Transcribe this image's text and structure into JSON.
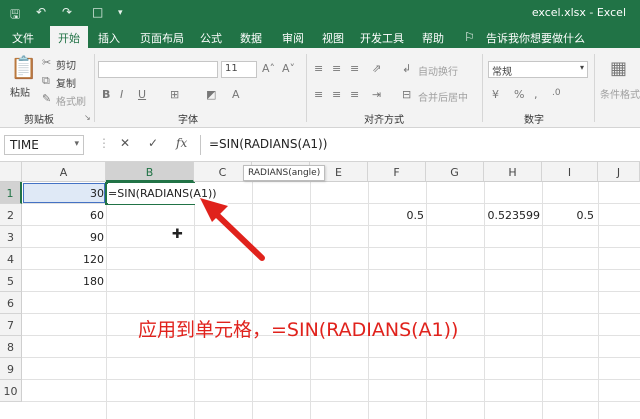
{
  "app": {
    "title": "excel.xlsx - Excel"
  },
  "tabs": [
    {
      "label": "文件"
    },
    {
      "label": "开始"
    },
    {
      "label": "插入"
    },
    {
      "label": "页面布局"
    },
    {
      "label": "公式"
    },
    {
      "label": "数据"
    },
    {
      "label": "审阅"
    },
    {
      "label": "视图"
    },
    {
      "label": "开发工具"
    },
    {
      "label": "帮助"
    }
  ],
  "tell_me": "告诉我你想要做什么",
  "ribbon": {
    "clipboard": {
      "paste": "粘贴",
      "cut": "剪切",
      "copy": "复制",
      "format_painter": "格式刷",
      "group": "剪贴板"
    },
    "font": {
      "size": "11",
      "group": "字体"
    },
    "alignment": {
      "wrap": "自动换行",
      "merge": "合并后居中",
      "group": "对齐方式"
    },
    "number": {
      "format": "常规",
      "group": "数字"
    },
    "styles": {
      "conditional": "条件格式"
    }
  },
  "formula_bar": {
    "name_box": "TIME",
    "formula": "=SIN(RADIANS(A1))"
  },
  "tooltip": "RADIANS(angle)",
  "columns": [
    "A",
    "B",
    "C",
    "D",
    "E",
    "F",
    "G",
    "H",
    "I",
    "J"
  ],
  "rows": [
    "1",
    "2",
    "3",
    "4",
    "5",
    "6",
    "7",
    "8",
    "9",
    "10"
  ],
  "cells": {
    "A1": "30",
    "A2": "60",
    "A3": "90",
    "A4": "120",
    "A5": "180",
    "B1": "=SIN(RADIANS(A1))",
    "F2": "0.5",
    "H2": "0.523599",
    "I2": "0.5"
  },
  "annotation": "应用到单元格，=SIN(RADIANS(A1))",
  "colors": {
    "brand": "#217346",
    "annotation": "#e0221c"
  }
}
